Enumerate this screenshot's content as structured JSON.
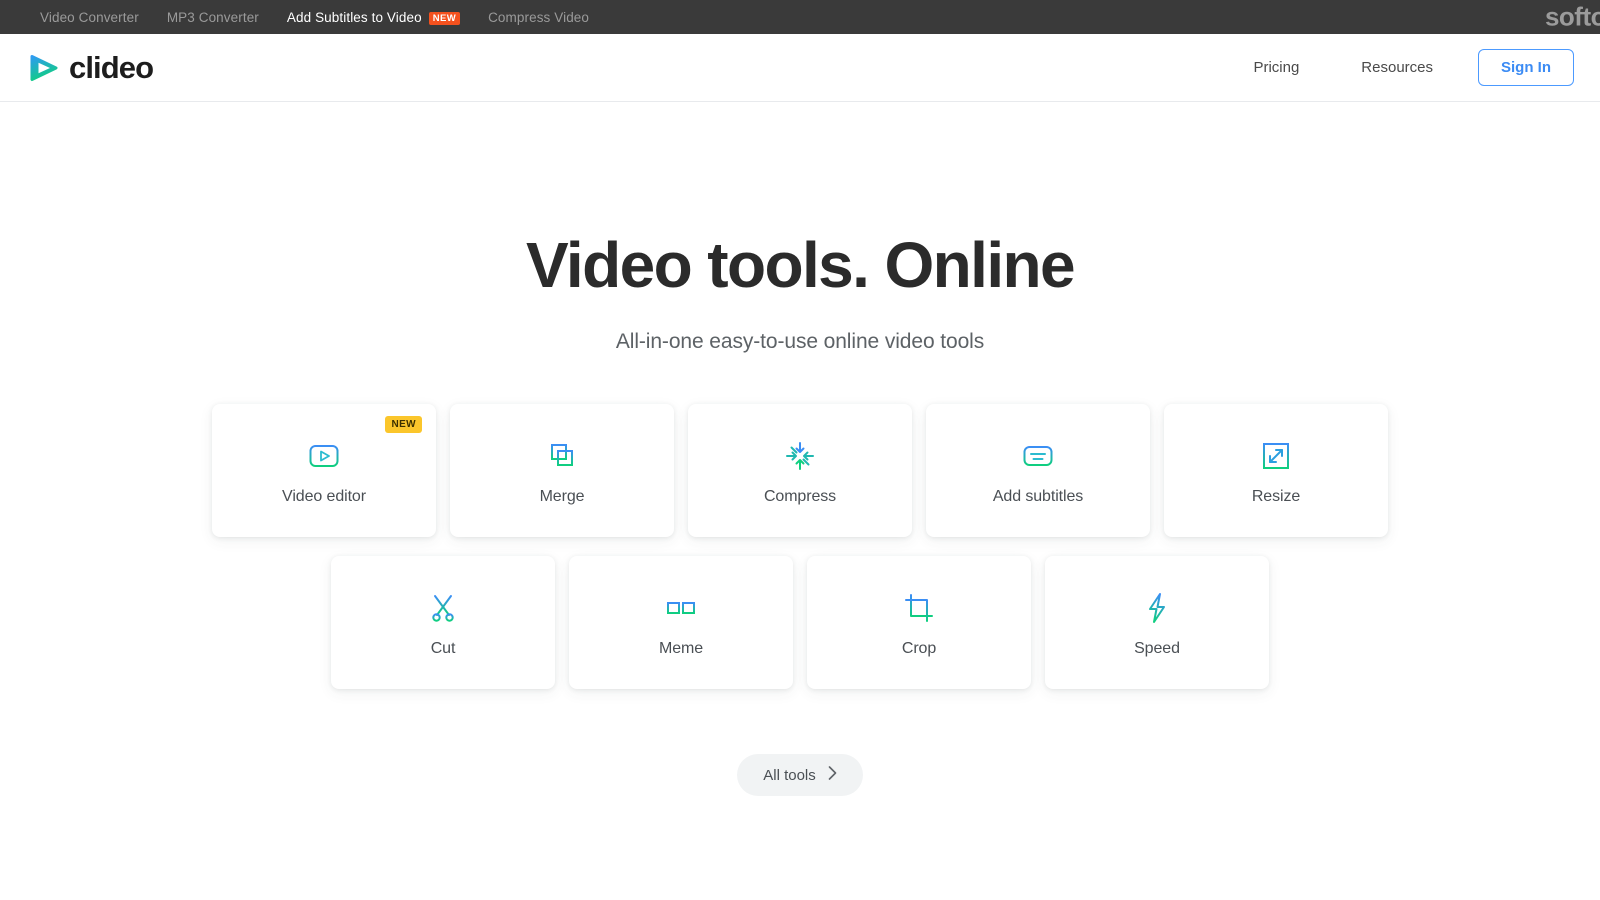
{
  "topbar": {
    "links": [
      {
        "label": "Video Converter",
        "active": false,
        "badge": null
      },
      {
        "label": "MP3 Converter",
        "active": false,
        "badge": null
      },
      {
        "label": "Add Subtitles to Video",
        "active": true,
        "badge": "NEW"
      },
      {
        "label": "Compress Video",
        "active": false,
        "badge": null
      }
    ],
    "brand": "softo",
    "badge_color": "#f4511e",
    "background": "#3a3a3a"
  },
  "header": {
    "logo_text": "clideo",
    "logo_icon": "play-triangle-gradient-icon",
    "nav": [
      {
        "label": "Pricing"
      },
      {
        "label": "Resources"
      }
    ],
    "signin_label": "Sign In",
    "signin_color": "#3b8bf4"
  },
  "hero": {
    "title": "Video tools. Online",
    "subtitle": "All-in-one easy-to-use online video tools"
  },
  "tools": {
    "row1": [
      {
        "label": "Video editor",
        "icon": "video-editor-icon",
        "badge": "NEW"
      },
      {
        "label": "Merge",
        "icon": "merge-icon",
        "badge": null
      },
      {
        "label": "Compress",
        "icon": "compress-icon",
        "badge": null
      },
      {
        "label": "Add subtitles",
        "icon": "add-subtitles-icon",
        "badge": null
      },
      {
        "label": "Resize",
        "icon": "resize-icon",
        "badge": null
      }
    ],
    "row2": [
      {
        "label": "Cut",
        "icon": "cut-icon",
        "badge": null
      },
      {
        "label": "Meme",
        "icon": "meme-icon",
        "badge": null
      },
      {
        "label": "Crop",
        "icon": "crop-icon",
        "badge": null
      },
      {
        "label": "Speed",
        "icon": "speed-icon",
        "badge": null
      }
    ],
    "badge_color": "#fbc62b",
    "gradient_start": "#3b8ef5",
    "gradient_end": "#0fcf7f"
  },
  "footer_cta": {
    "label": "All tools",
    "icon": "chevron-right-icon"
  }
}
